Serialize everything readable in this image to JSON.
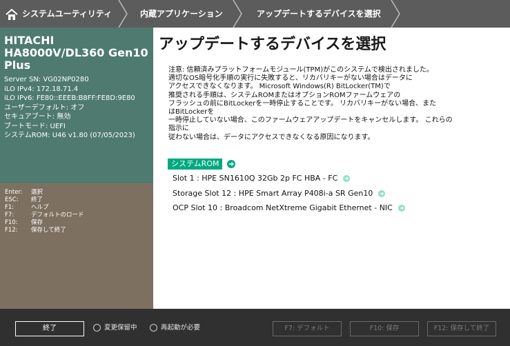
{
  "breadcrumb": [
    "システムユーティリティ",
    "内蔵アプリケーション",
    "アップデートするデバイスを選択"
  ],
  "system": {
    "model": "HITACHI HA8000V/DL360 Gen10 Plus",
    "info": [
      "Server SN: VG02NP0280",
      "iLO IPv4: 172.18.71.4",
      "iLO IPv6: FE80::EEEB:B8FF:FE8D:9E80",
      "ユーザーデフォルト: オフ",
      "セキュアブート: 無効",
      "ブートモード: UEFI",
      "システムROM: U46 v1.80 (07/05/2023)"
    ]
  },
  "keys": [
    {
      "key": "Enter:",
      "label": "選択"
    },
    {
      "key": "ESC:",
      "label": "終了"
    },
    {
      "key": "F1:",
      "label": "ヘルプ"
    },
    {
      "key": "F7:",
      "label": "デフォルトのロード"
    },
    {
      "key": "F10:",
      "label": "保存"
    },
    {
      "key": "F12:",
      "label": "保存して終了"
    }
  ],
  "main": {
    "title": "アップデートするデバイスを選択",
    "warning": "注意: 信頼済みプラットフォームモジュール(TPM)がこのシステムで検出されました。\n適切なOS暗号化手順の実行に失敗すると、リカバリキーがない場合はデータに\nアクセスできなくなります。 Microsoft Windows(R) BitLocker(TM)で\n推奨される手順は、システムROMまたはオプションROMファームウェアの\nフラッシュの前にBitLockerを一時停止することです。 リカバリキーがない場合、また\nはBitLockerを\n一時停止していない場合、このファームウェアアップデートをキャンセルします。 これらの\n指示に\n従わない場合は、データにアクセスできなくなる原因になります。",
    "section": "システムROM",
    "devices": [
      "Slot 1 : HPE SN1610Q 32Gb 2p FC HBA - FC",
      "Storage Slot 12 : HPE Smart Array P408i-a SR Gen10",
      "OCP Slot 10 : Broadcom NetXtreme Gigabit Ethernet - NIC"
    ]
  },
  "footer": {
    "exit": "終了",
    "status_changes": "変更保留中",
    "status_reboot": "再起動が必要",
    "f7": "F7: デフォルト",
    "f10": "F10: 保存",
    "f12": "F12: 保存して終了"
  },
  "colors": {
    "accent": "#01a982",
    "sysinfo_bg": "#4e7a6f",
    "keys_bg": "#7d7060"
  }
}
